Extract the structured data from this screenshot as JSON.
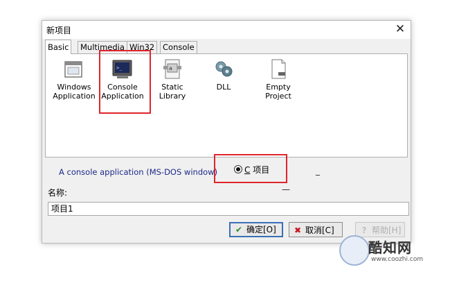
{
  "window": {
    "title": "新项目",
    "close_glyph": "✕"
  },
  "tabs": [
    {
      "label": "Basic",
      "active": true
    },
    {
      "label": "Multimedia",
      "active": false
    },
    {
      "label": "Win32",
      "active": false
    },
    {
      "label": "Console",
      "active": false
    }
  ],
  "templates": [
    {
      "line1": "Windows",
      "line2": "Application",
      "icon": "window-app-icon"
    },
    {
      "line1": "Console",
      "line2": "Application",
      "icon": "console-app-icon",
      "selected": true
    },
    {
      "line1": "Static Library",
      "line2": "",
      "icon": "static-library-icon"
    },
    {
      "line1": "DLL",
      "line2": "",
      "icon": "dll-icon"
    },
    {
      "line1": "Empty Project",
      "line2": "",
      "icon": "empty-project-icon"
    }
  ],
  "description": "A console application (MS-DOS window)",
  "language": {
    "label_hotkey": "C",
    "label_rest": " 项目",
    "selected": true
  },
  "dash1": "_",
  "dash2": "—",
  "name_label": "名称:",
  "name_value": "项目1",
  "buttons": {
    "ok": "确定[O]",
    "cancel": "取消[C]",
    "help": "帮助[H]"
  },
  "watermark": {
    "name": "酷知网",
    "url": "www.coozhi.com"
  },
  "colors": {
    "highlight": "#e0242b",
    "description_text": "#1d2a8a",
    "ok_check": "#2e8b2e",
    "cancel_x": "#c8161d"
  }
}
